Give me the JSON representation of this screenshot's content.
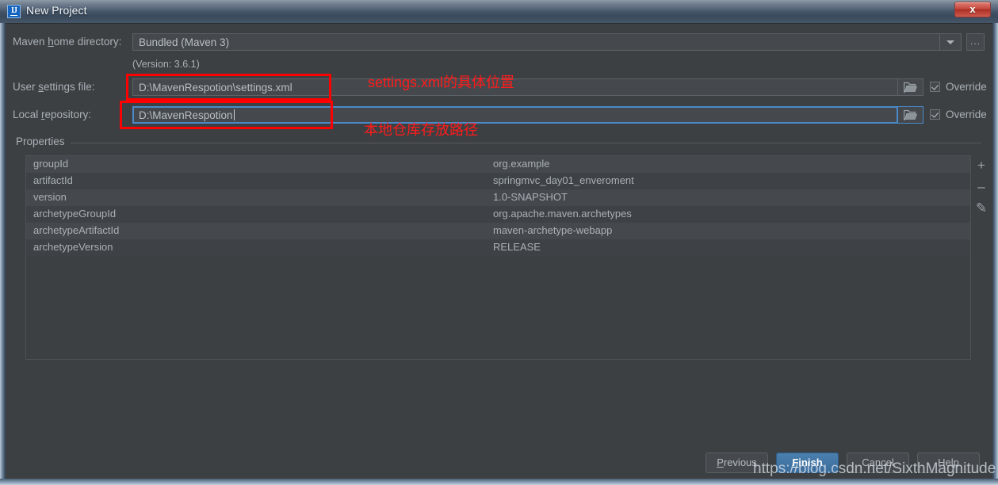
{
  "window": {
    "title": "New Project",
    "app_icon": "intellij-idea-icon",
    "close_label": "x"
  },
  "form": {
    "maven_home": {
      "label_prefix": "Maven ",
      "label_accel": "h",
      "label_suffix": "ome directory:",
      "label_full": "Maven home directory:",
      "value": "Bundled (Maven 3)",
      "dropdown_icon": "chevron-down-icon",
      "browse_label": "..."
    },
    "version_note": "(Version: 3.6.1)",
    "user_settings": {
      "label_prefix": "User ",
      "label_accel": "s",
      "label_suffix": "ettings file:",
      "label_full": "User settings file:",
      "value": "D:\\MavenRespotion\\settings.xml",
      "browse_icon": "folder-icon",
      "override_label": "Override",
      "override_checked": true
    },
    "local_repository": {
      "label_prefix": "Local ",
      "label_accel": "r",
      "label_suffix": "epository:",
      "label_full": "Local repository:",
      "value": "D:\\MavenRespotion",
      "focused": true,
      "browse_icon": "folder-icon",
      "override_label": "Override",
      "override_checked": true
    }
  },
  "properties": {
    "legend": "Properties",
    "rows": [
      {
        "key": "groupId",
        "value": "org.example"
      },
      {
        "key": "artifactId",
        "value": "springmvc_day01_enveroment"
      },
      {
        "key": "version",
        "value": "1.0-SNAPSHOT"
      },
      {
        "key": "archetypeGroupId",
        "value": "org.apache.maven.archetypes"
      },
      {
        "key": "archetypeArtifactId",
        "value": "maven-archetype-webapp"
      },
      {
        "key": "archetypeVersion",
        "value": "RELEASE"
      }
    ],
    "actions": [
      {
        "name": "add-property-button",
        "glyph": "+"
      },
      {
        "name": "remove-property-button",
        "glyph": "–"
      },
      {
        "name": "edit-property-button",
        "glyph": "✎"
      }
    ]
  },
  "footer": {
    "previous": {
      "prefix": "",
      "accel": "P",
      "suffix": "revious",
      "full": "Previous"
    },
    "finish": {
      "prefix": "",
      "accel": "F",
      "suffix": "inish",
      "full": "Finish"
    },
    "cancel": "Cancel",
    "help": "Help"
  },
  "annotations": {
    "settings_note": "settings.xml的具体位置",
    "repository_note": "本地仓库存放路径",
    "watermark": "https://blog.csdn.net/SixthMagnitude"
  },
  "colors": {
    "dialog_bg": "#3c4043",
    "field_bg": "#45494d",
    "text": "#a9b0b6",
    "accent": "#3c6d9c",
    "annotation_red": "#ff0000",
    "close_red": "#c6483c"
  }
}
